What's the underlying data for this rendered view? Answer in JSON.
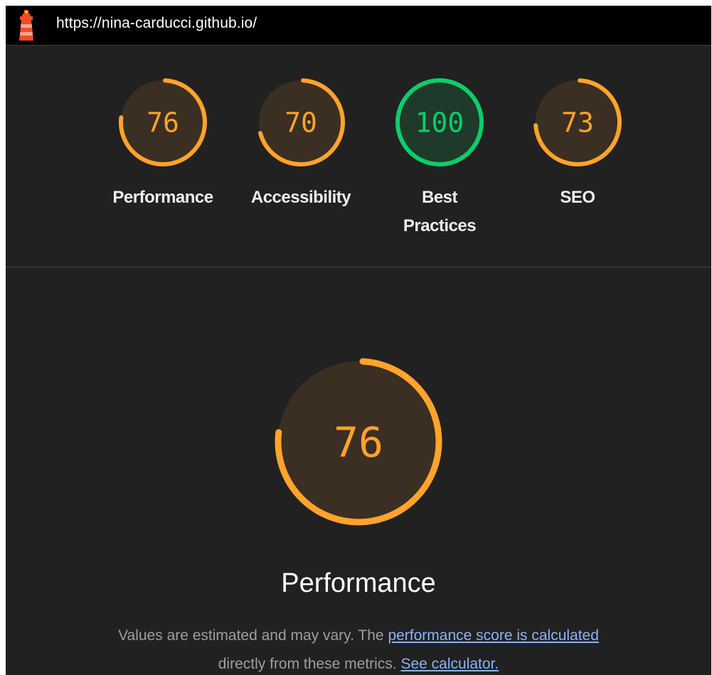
{
  "topbar": {
    "logo_icon": "lighthouse-icon",
    "url": "https://nina-carducci.github.io/"
  },
  "colors": {
    "average": "#ffa32a",
    "average_fill": "#3a2f22",
    "pass": "#0cce6b",
    "pass_fill": "#1f3a2a",
    "background": "#212121"
  },
  "categories": [
    {
      "label": "Performance",
      "score": 76,
      "rating": "average"
    },
    {
      "label": "Accessibility",
      "score": 70,
      "rating": "average"
    },
    {
      "label": "Best Practices",
      "score": 100,
      "rating": "pass"
    },
    {
      "label": "SEO",
      "score": 73,
      "rating": "average"
    }
  ],
  "main": {
    "score": 76,
    "title": "Performance",
    "desc_prefix": "Values are estimated and may vary. The ",
    "desc_link1": "performance score is calculated",
    "desc_middle": " directly from these metrics. ",
    "desc_link2": "See calculator."
  }
}
